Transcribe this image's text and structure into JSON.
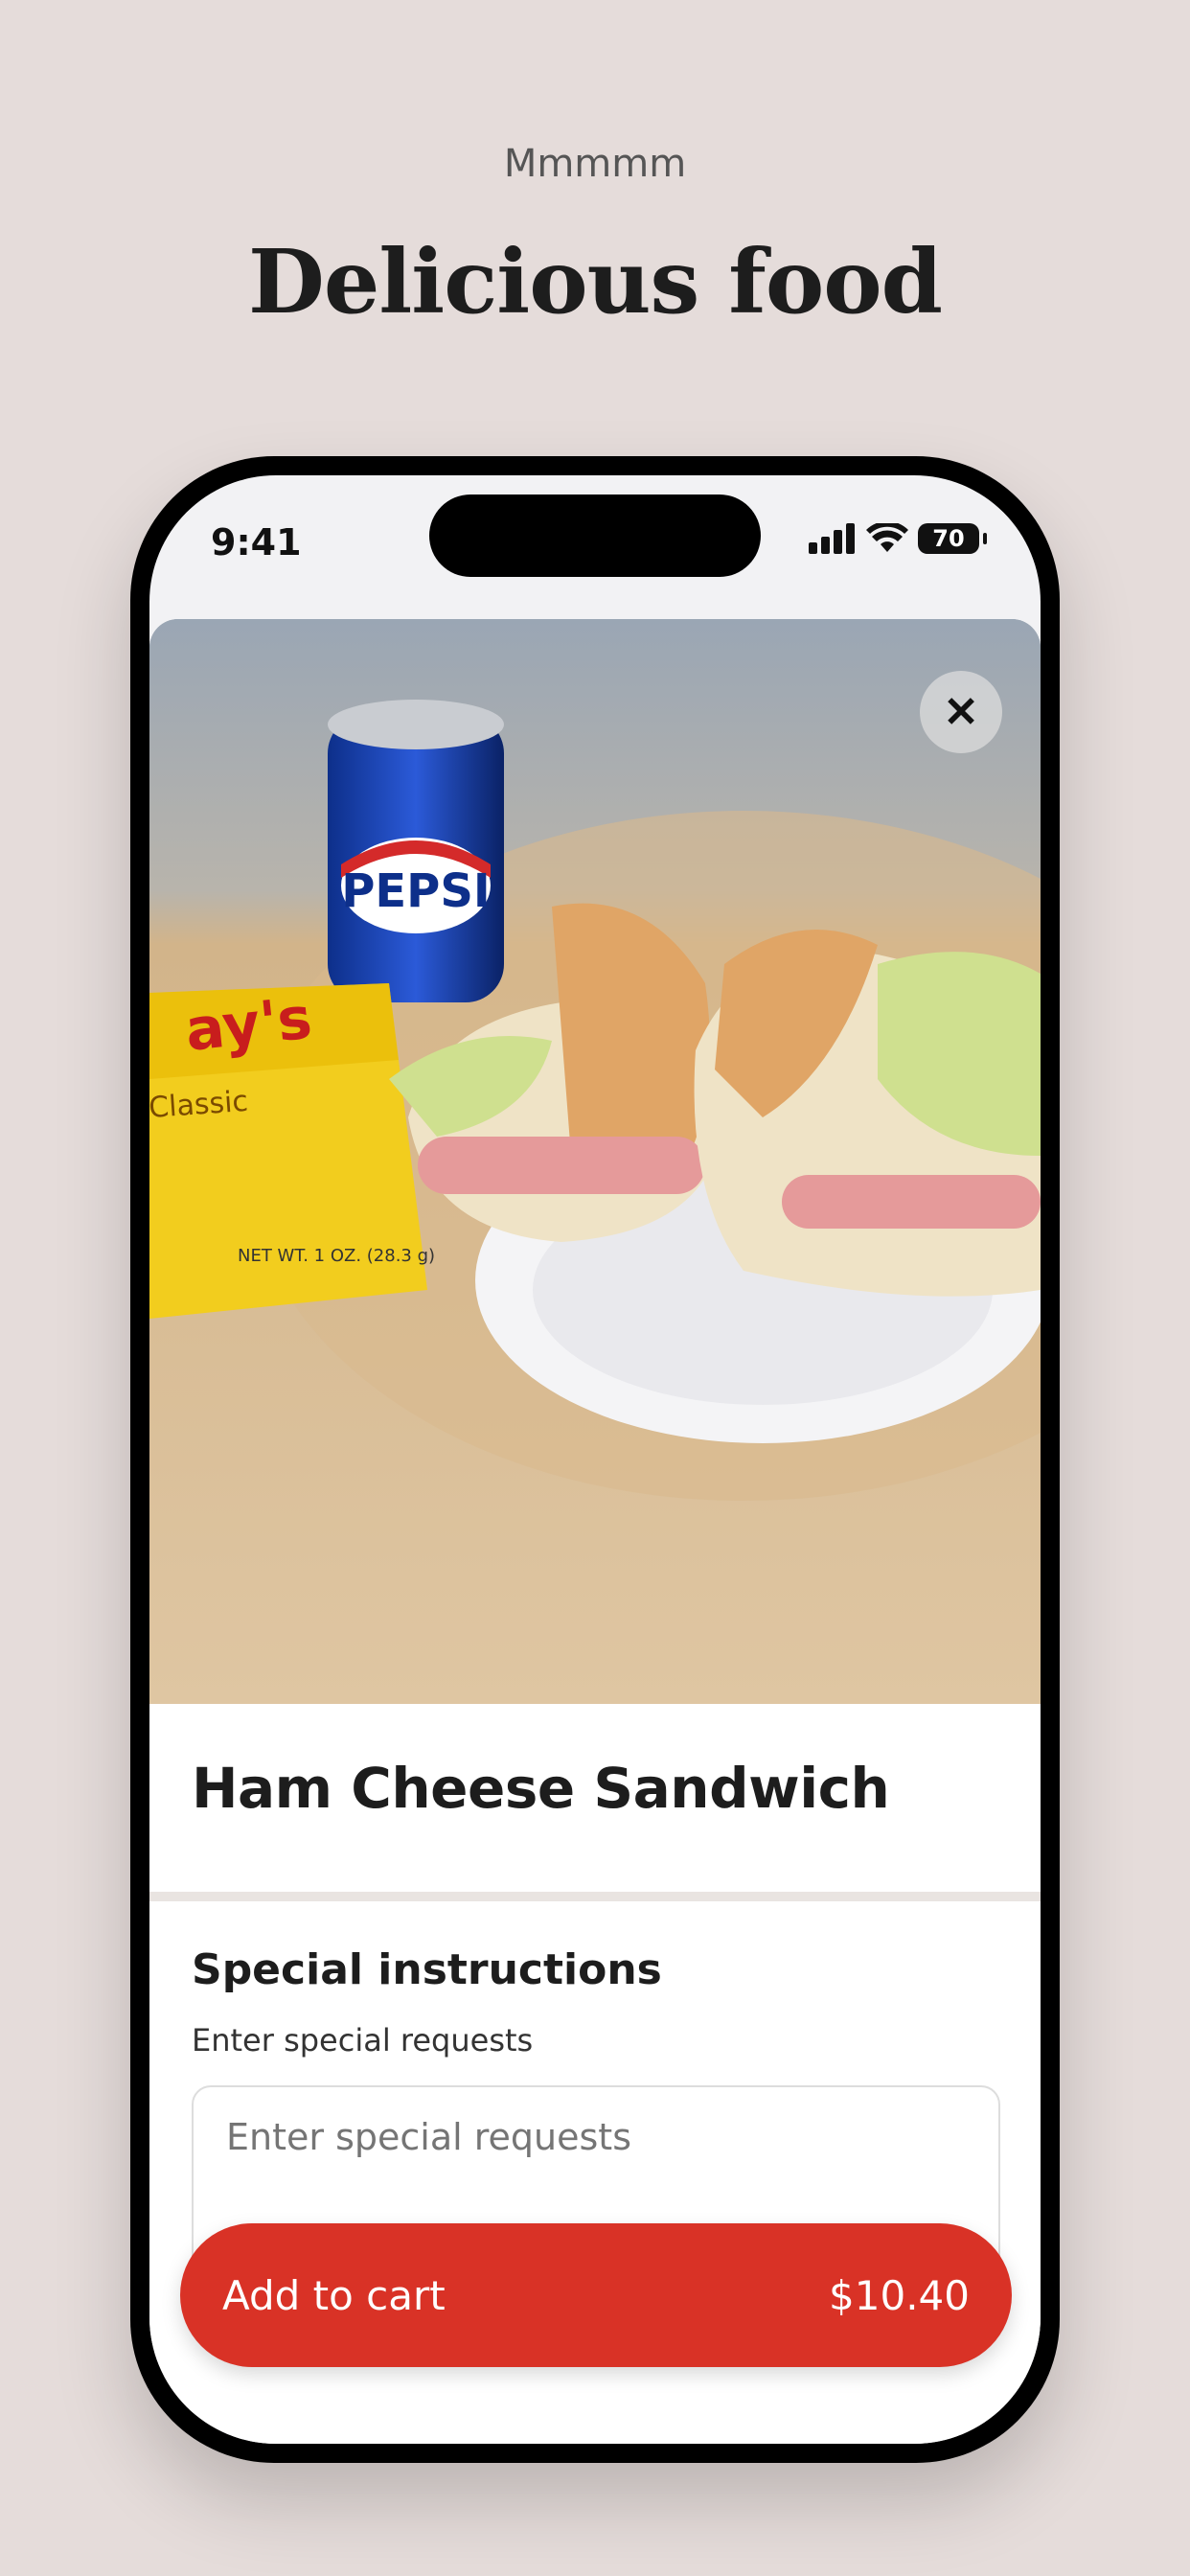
{
  "promo": {
    "subtitle": "Mmmmm",
    "headline": "Delicious food"
  },
  "status_bar": {
    "time": "9:41",
    "battery": "70",
    "icons": [
      "signal-icon",
      "wifi-icon",
      "battery-icon"
    ]
  },
  "item": {
    "image_icon": "close-icon",
    "close_symbol": "✕",
    "name": "Ham Cheese Sandwich"
  },
  "special_instructions": {
    "title": "Special instructions",
    "label": "Enter special requests",
    "placeholder": "Enter special requests"
  },
  "cart": {
    "label": "Add to cart",
    "price": "$10.40"
  },
  "colors": {
    "background": "#e5dcda",
    "accent": "#d93226"
  }
}
